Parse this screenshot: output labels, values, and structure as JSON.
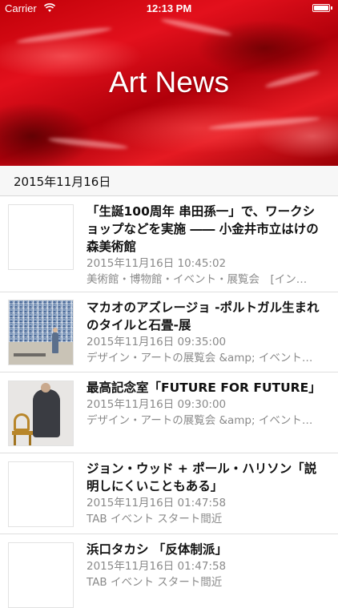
{
  "status_bar": {
    "carrier": "Carrier",
    "time": "12:13 PM",
    "wifi_icon": "wifi-icon",
    "battery_icon": "battery-icon"
  },
  "header": {
    "title": "Art News",
    "background": "red-paint-texture"
  },
  "section": {
    "date": "2015年11月16日"
  },
  "articles": [
    {
      "title": "「生誕100周年 串田孫一」で、ワークショップなどを実施 ―― 小金井市立はけの森美術館",
      "date": "2015年11月16日 10:45:02",
      "category": "美術館・博物館・イベント・展覧会　[イン…",
      "thumbnail": "blank"
    },
    {
      "title": "マカオのアズレージョ -ポルトガル生まれのタイルと石畳-展",
      "date": "2015年11月16日 09:35:00",
      "category": "デザイン・アートの展覧会 &amp; イベント…",
      "thumbnail": "tiles-photo"
    },
    {
      "title": "最高記念室「FUTURE FOR FUTURE」",
      "date": "2015年11月16日 09:30:00",
      "category": "デザイン・アートの展覧会 &amp; イベント…",
      "thumbnail": "figure-chair-photo"
    },
    {
      "title": "ジョン・ウッド + ポール・ハリソン「説明しにくいこともある」",
      "date": "2015年11月16日 01:47:58",
      "category": "TAB イベント スタート間近",
      "thumbnail": "blank"
    },
    {
      "title": "浜口タカシ 「反体制派」",
      "date": "2015年11月16日 01:47:58",
      "category": "TAB イベント スタート間近",
      "thumbnail": "blank"
    }
  ],
  "colors": {
    "accent_red": "#e3101c",
    "meta_gray": "#8a8a8a",
    "section_bg": "#f7f7f7"
  }
}
